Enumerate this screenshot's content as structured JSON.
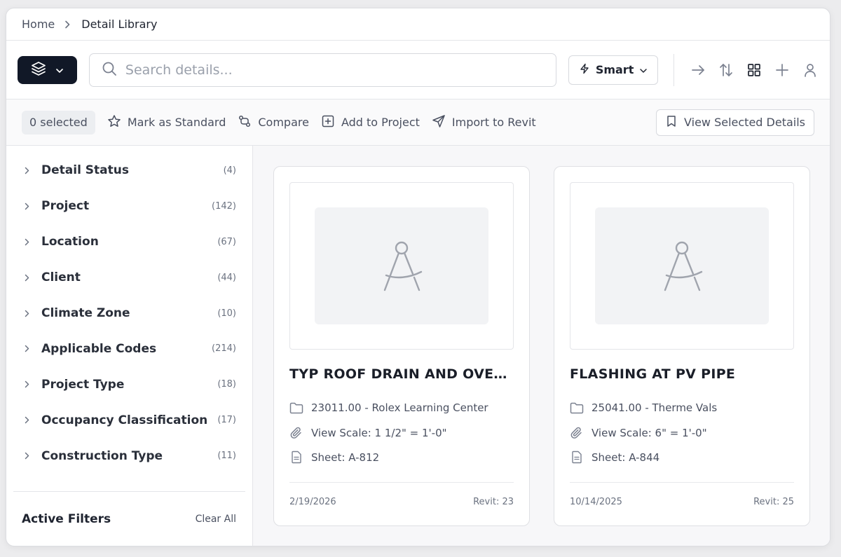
{
  "breadcrumb": {
    "home": "Home",
    "current": "Detail Library"
  },
  "toolbar": {
    "search_placeholder": "Search details...",
    "smart_label": "Smart",
    "icons": [
      "arrow-right-icon",
      "sort-icon",
      "grid-view-icon",
      "plus-icon",
      "user-icon"
    ]
  },
  "actions": {
    "selected": "0 selected",
    "mark_standard": "Mark as Standard",
    "compare": "Compare",
    "add_project": "Add to Project",
    "import_revit": "Import to Revit",
    "view_selected": "View Selected Details"
  },
  "facets": [
    {
      "label": "Detail Status",
      "count": "(4)"
    },
    {
      "label": "Project",
      "count": "(142)"
    },
    {
      "label": "Location",
      "count": "(67)"
    },
    {
      "label": "Client",
      "count": "(44)"
    },
    {
      "label": "Climate Zone",
      "count": "(10)"
    },
    {
      "label": "Applicable Codes",
      "count": "(214)"
    },
    {
      "label": "Project Type",
      "count": "(18)"
    },
    {
      "label": "Occupancy Classification",
      "count": "(17)"
    },
    {
      "label": "Construction Type",
      "count": "(11)"
    }
  ],
  "active_filters": {
    "title": "Active Filters",
    "clear": "Clear All"
  },
  "cards": [
    {
      "title": "TYP ROOF DRAIN AND OVERFLOW",
      "project": "23011.00 - Rolex Learning Center",
      "scale": "View Scale: 1 1/2\" = 1'-0\"",
      "sheet": "Sheet: A-812",
      "date": "2/19/2026",
      "revit": "Revit: 23"
    },
    {
      "title": "FLASHING AT PV PIPE",
      "project": "25041.00 - Therme Vals",
      "scale": "View Scale: 6\" = 1'-0\"",
      "sheet": "Sheet: A-844",
      "date": "10/14/2025",
      "revit": "Revit: 25"
    }
  ],
  "colors": {
    "primary_dark": "#111827",
    "text": "#1f2430",
    "muted": "#6b7280",
    "border": "#dfe0e4"
  }
}
